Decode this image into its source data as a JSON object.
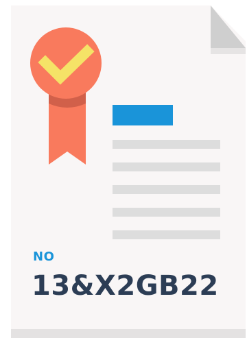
{
  "certificate": {
    "number_label": "NO",
    "number_value": "13&X2GB22"
  },
  "colors": {
    "paper": "#f9f6f6",
    "paper_fold": "#cfcfcf",
    "paper_shadow": "#e4e2e2",
    "line": "#dddddd",
    "accent_bar": "#1a94d9",
    "badge": "#f97a5d",
    "badge_shadow": "#d1604a",
    "check": "#f5e367",
    "label_blue": "#1a94d9",
    "serial_text": "#2c3d55"
  },
  "icons": {
    "badge": "award-ribbon-icon",
    "check": "check-icon"
  }
}
